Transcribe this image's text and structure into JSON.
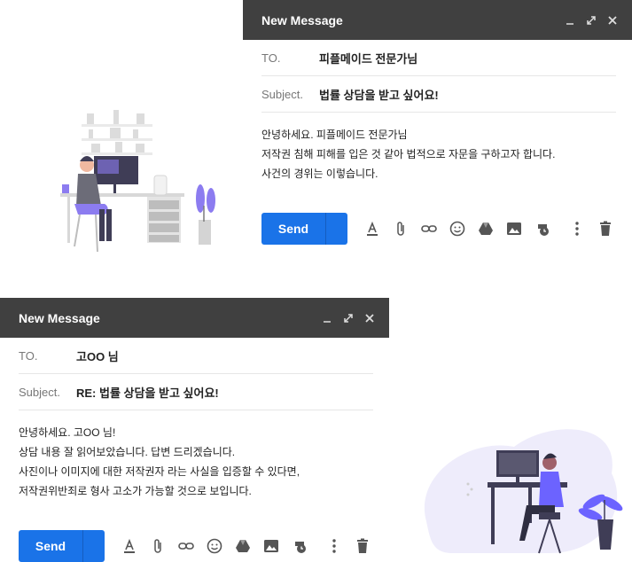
{
  "top": {
    "window_title": "New Message",
    "to_label": "TO.",
    "to_value": "피플메이드 전문가님",
    "subject_label": "Subject.",
    "subject_value": "법률 상담을 받고 싶어요!",
    "body_lines": [
      "안녕하세요. 피플메이드 전문가님",
      "저작권 침해 피해를 입은 것 같아 법적으로 자문을 구하고자 합니다.",
      "사건의 경위는 이렇습니다."
    ],
    "send_label": "Send"
  },
  "bottom": {
    "window_title": "New Message",
    "to_label": "TO.",
    "to_value": "고OO 님",
    "subject_label": "Subject.",
    "subject_value": "RE: 법률 상담을 받고 싶어요!",
    "body_lines": [
      "안녕하세요. 고OO 님!",
      "상담 내용 잘 읽어보았습니다. 답변 드리겠습니다.",
      "사진이나 이미지에 대한 저작권자 라는 사실을 입증할 수 있다면,",
      "저작권위반죄로 형사 고소가 가능할 것으로 보입니다."
    ],
    "send_label": "Send"
  },
  "colors": {
    "header": "#404040",
    "send": "#1a73e8",
    "accent_purple": "#8c7cf0",
    "blob": "#eeecfb"
  },
  "icons": [
    "minimize-icon",
    "expand-icon",
    "close-icon",
    "text-format-icon",
    "attach-icon",
    "link-icon",
    "emoji-icon",
    "drive-icon",
    "image-icon",
    "schedule-icon",
    "more-icon",
    "trash-icon"
  ]
}
